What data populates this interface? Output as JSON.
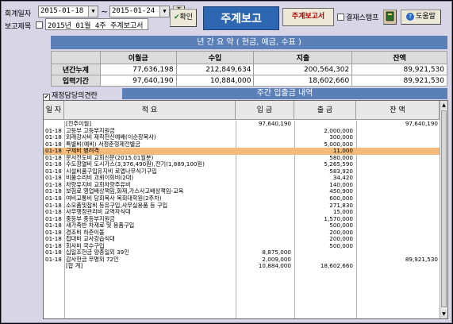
{
  "toolbar": {
    "period_label": "회계일자",
    "date_from": "2015-01-18",
    "tilde": "~",
    "date_to": "2015-01-24",
    "week_btn": "주",
    "report_title_label": "보고제목",
    "report_title_value": "2015년 01월 4주 주계보고서",
    "confirm_btn": "확인",
    "screen_title": "주계보고",
    "report_btn": "주계보고서",
    "stamp_label": "결재스탬프",
    "help_btn": "도움말"
  },
  "annual": {
    "title": "년 간 요 약 ( 현금, 예금, 수표 )",
    "headers": [
      "이월금",
      "수입",
      "지출",
      "잔액"
    ],
    "rows": [
      {
        "label": "년간누계",
        "values": [
          "77,636,198",
          "212,849,634",
          "200,564,302",
          "89,921,530"
        ]
      },
      {
        "label": "입력기간",
        "values": [
          "97,640,190",
          "10,884,000",
          "18,602,660",
          "89,921,530"
        ]
      }
    ]
  },
  "weekly": {
    "checkbox_label": "재정담당의견란",
    "title": "주간 입출금 내역",
    "headers": [
      "일 자",
      "적 요",
      "입 금",
      "출 금",
      "잔 액"
    ],
    "rows": [
      {
        "date": "",
        "desc": "[전주이월]",
        "in": "97,640,190",
        "out": "",
        "bal": "97,640,190"
      },
      {
        "date": "01-18",
        "desc": "고등부  고등부지원금",
        "in": "",
        "out": "2,000,000",
        "bal": ""
      },
      {
        "date": "01-18",
        "desc": "외래강사비  제직헌신예배(이순창목사)",
        "in": "",
        "out": "300,000",
        "bal": ""
      },
      {
        "date": "01-18",
        "desc": "특별비(예비)  서정춘형제전별금",
        "in": "",
        "out": "5,000,000",
        "bal": ""
      },
      {
        "date": "01-18",
        "desc": "구제비  병려격",
        "in": "",
        "out": "11,000",
        "bal": "",
        "highlight": true
      },
      {
        "date": "01-18",
        "desc": "문서전도비  교회신문(2015.01월분)",
        "in": "",
        "out": "580,000",
        "bal": ""
      },
      {
        "date": "01-18",
        "desc": "수도광열비  도시가스(3,376,490원),전기(1,889,100원)",
        "in": "",
        "out": "5,265,590",
        "bal": ""
      },
      {
        "date": "01-18",
        "desc": "시설비품구입유지비  로앱나무식기구입",
        "in": "",
        "out": "583,920",
        "bal": ""
      },
      {
        "date": "01-18",
        "desc": "비품수리비  괴뢰이회비(2대)",
        "in": "",
        "out": "34,420",
        "bal": ""
      },
      {
        "date": "01-18",
        "desc": "차량유지비  교회차량주유비",
        "in": "",
        "out": "140,000",
        "bal": ""
      },
      {
        "date": "01-18",
        "desc": "보험료  영업배상책임,화재,가스사고배상책임-교육",
        "in": "",
        "out": "450,900",
        "bal": ""
      },
      {
        "date": "01-18",
        "desc": "여비교통비  당회목사 목회대학원(2주차)",
        "in": "",
        "out": "600,000",
        "bal": ""
      },
      {
        "date": "01-18",
        "desc": "소모품및잡비  등유구입,사무실용품 등 구입",
        "in": "",
        "out": "271,830",
        "bal": ""
      },
      {
        "date": "01-18",
        "desc": "사무행정관리비  교역자식대",
        "in": "",
        "out": "15,000",
        "bal": ""
      },
      {
        "date": "01-18",
        "desc": "중등부  중등부지원금",
        "in": "",
        "out": "1,570,000",
        "bal": ""
      },
      {
        "date": "01-18",
        "desc": "새가족반  차재료 및 용품구입",
        "in": "",
        "out": "500,000",
        "bal": ""
      },
      {
        "date": "01-18",
        "desc": "경조비  하준이돌",
        "in": "",
        "out": "200,000",
        "bal": ""
      },
      {
        "date": "01-18",
        "desc": "접대비  교사강습식대",
        "in": "",
        "out": "200,000",
        "bal": ""
      },
      {
        "date": "01-18",
        "desc": "회사비  국수구입",
        "in": "",
        "out": "500,000",
        "bal": ""
      },
      {
        "date": "01-18",
        "desc": "십일조헌금  양종일외 39인",
        "in": "8,875,000",
        "out": "",
        "bal": ""
      },
      {
        "date": "01-18",
        "desc": "감사헌금  무명외 72인",
        "in": "2,009,000",
        "out": "",
        "bal": "89,921,530"
      },
      {
        "date": "",
        "desc": "[합  계]",
        "in": "10,884,000",
        "out": "18,602,660",
        "bal": ""
      }
    ]
  }
}
